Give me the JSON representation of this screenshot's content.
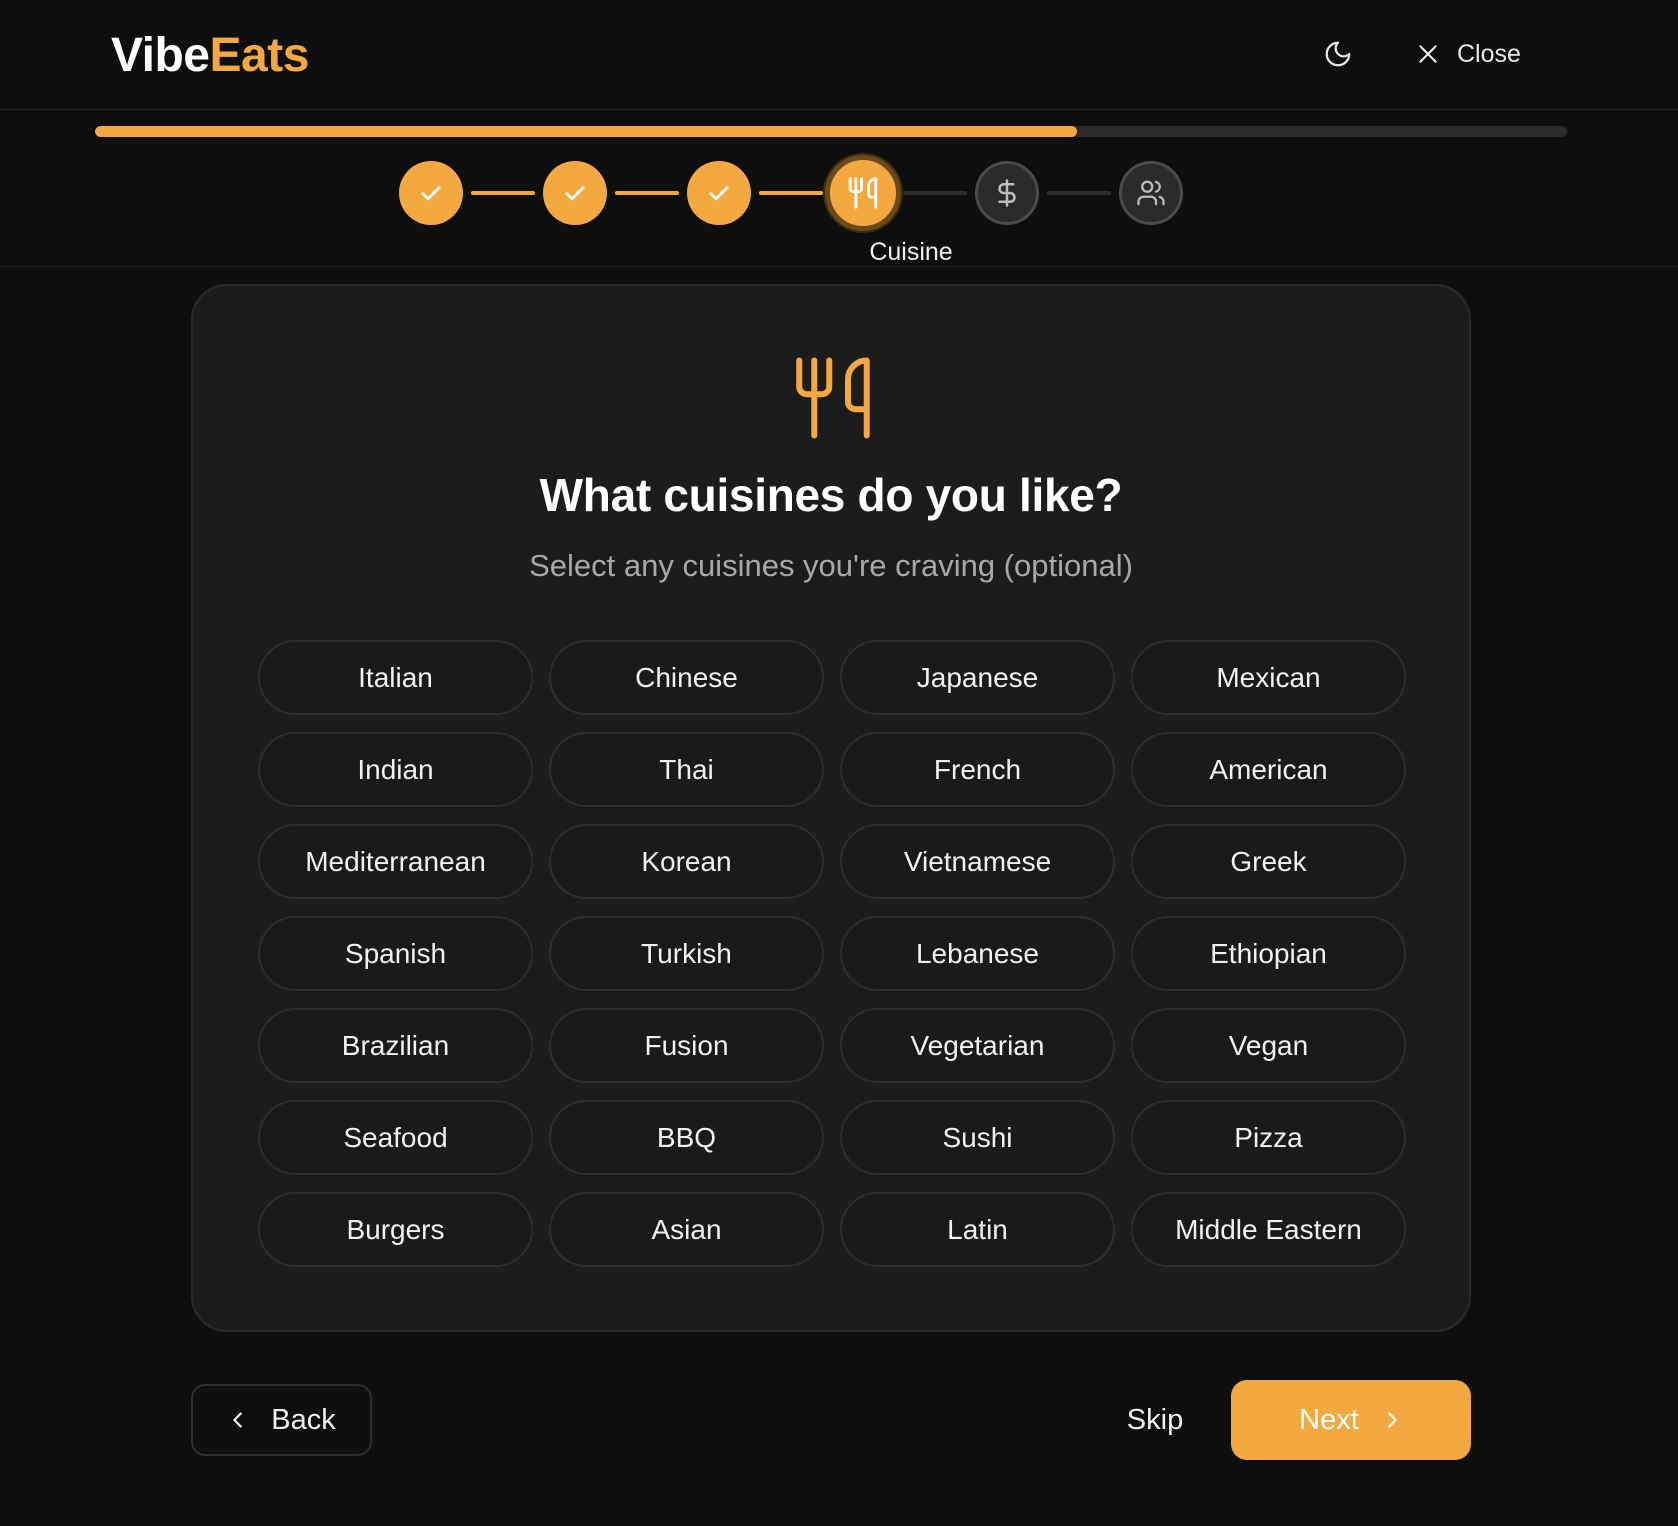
{
  "header": {
    "logo_part1": "Vibe",
    "logo_part2": "Eats",
    "theme_icon": "moon-icon",
    "close_label": "Close"
  },
  "progress": {
    "percent": 66.7,
    "current_step_label": "Cuisine",
    "steps": [
      {
        "status": "done",
        "icon": "check-icon"
      },
      {
        "status": "done",
        "icon": "check-icon"
      },
      {
        "status": "done",
        "icon": "check-icon"
      },
      {
        "status": "active",
        "icon": "utensils-icon"
      },
      {
        "status": "todo",
        "icon": "dollar-icon"
      },
      {
        "status": "todo",
        "icon": "users-icon"
      }
    ]
  },
  "card": {
    "icon": "utensils-icon",
    "title": "What cuisines do you like?",
    "subtitle": "Select any cuisines you're craving (optional)",
    "cuisines": [
      "Italian",
      "Chinese",
      "Japanese",
      "Mexican",
      "Indian",
      "Thai",
      "French",
      "American",
      "Mediterranean",
      "Korean",
      "Vietnamese",
      "Greek",
      "Spanish",
      "Turkish",
      "Lebanese",
      "Ethiopian",
      "Brazilian",
      "Fusion",
      "Vegetarian",
      "Vegan",
      "Seafood",
      "BBQ",
      "Sushi",
      "Pizza",
      "Burgers",
      "Asian",
      "Latin",
      "Middle Eastern"
    ]
  },
  "footer": {
    "back_label": "Back",
    "skip_label": "Skip",
    "next_label": "Next"
  },
  "colors": {
    "accent": "#f4a940",
    "background": "#0e0e0e",
    "card": "#1c1c1c"
  }
}
